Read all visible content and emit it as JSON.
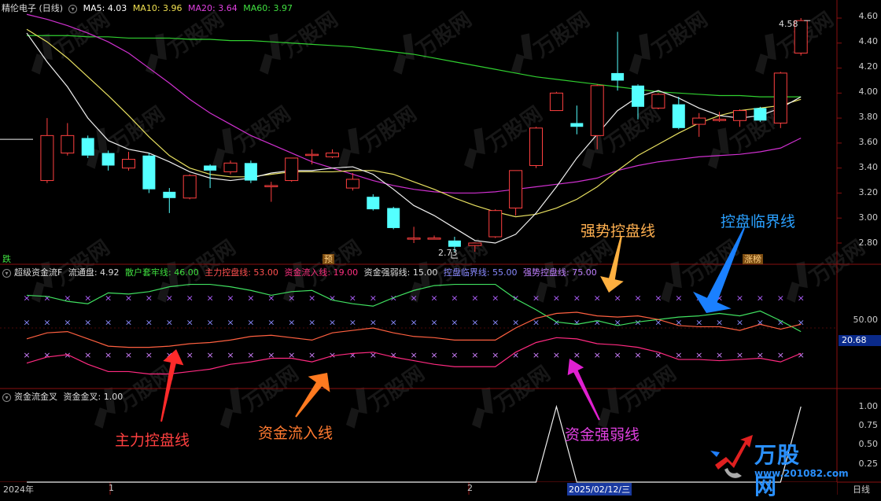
{
  "header_main": {
    "title": "精伦电子 (日线)",
    "ma": [
      {
        "label": "MA5: 4.03",
        "color": "#ffffff"
      },
      {
        "label": "MA10: 3.96",
        "color": "#f0e050"
      },
      {
        "label": "MA20: 3.64",
        "color": "#e040e0"
      },
      {
        "label": "MA60: 3.97",
        "color": "#40e040"
      }
    ]
  },
  "header_ind": {
    "title": "超级资金流F",
    "items": [
      {
        "label": "流通盘: 4.92",
        "color": "#dddddd"
      },
      {
        "label": "散户套牢线: 46.00",
        "color": "#40e040"
      },
      {
        "label": "主力控盘线: 53.00",
        "color": "#ff5050"
      },
      {
        "label": "资金流入线: 19.00",
        "color": "#ff3080"
      },
      {
        "label": "资金强弱线: 15.00",
        "color": "#dddddd"
      },
      {
        "label": "控盘临界线: 55.00",
        "color": "#8a8aff"
      },
      {
        "label": "强势控盘线: 75.00",
        "color": "#c080ff"
      }
    ]
  },
  "header_sub": {
    "title": "资金流金叉",
    "items": [
      {
        "label": "资金金叉: 1.00",
        "color": "#dddddd"
      }
    ]
  },
  "price_axis": [
    "4.60",
    "4.40",
    "4.20",
    "4.00",
    "3.80",
    "3.60",
    "3.40",
    "3.20",
    "3.00",
    "2.80"
  ],
  "ind_axis": {
    "tick": "50.00",
    "value_box": "20.68"
  },
  "sub_axis": [
    "1.00",
    "0.75",
    "0.50",
    "0.25"
  ],
  "date_axis": {
    "year": "2024年",
    "m1": "1",
    "m2": "2",
    "cursor": "2025/02/12/三",
    "period": "日线"
  },
  "markers": {
    "low_label": "2.73",
    "high_label": "4.58",
    "left_tag": "跌",
    "mid_tag": "预",
    "right_tag": "涨榜"
  },
  "annotations": {
    "strong": "强势控盘线",
    "critical": "控盘临界线",
    "main": "主力控盘线",
    "inflow": "资金流入线",
    "strength": "资金强弱线"
  },
  "watermark": {
    "brand": "万股网",
    "url": "www.201082.com"
  },
  "chart_data": {
    "type": "candlestick",
    "ylim": [
      2.7,
      4.7
    ],
    "candles": [
      {
        "o": 3.63,
        "c": 3.63,
        "h": 3.63,
        "l": 3.63
      },
      {
        "o": 3.3,
        "c": 3.66,
        "h": 3.8,
        "l": 3.28
      },
      {
        "o": 3.52,
        "c": 3.66,
        "h": 3.76,
        "l": 3.5
      },
      {
        "o": 3.64,
        "c": 3.5,
        "h": 3.66,
        "l": 3.48
      },
      {
        "o": 3.52,
        "c": 3.42,
        "h": 3.54,
        "l": 3.38
      },
      {
        "o": 3.4,
        "c": 3.47,
        "h": 3.53,
        "l": 3.38
      },
      {
        "o": 3.5,
        "c": 3.23,
        "h": 3.52,
        "l": 3.2
      },
      {
        "o": 3.21,
        "c": 3.16,
        "h": 3.24,
        "l": 3.04
      },
      {
        "o": 3.16,
        "c": 3.34,
        "h": 3.35,
        "l": 3.15
      },
      {
        "o": 3.42,
        "c": 3.38,
        "h": 3.43,
        "l": 3.24
      },
      {
        "o": 3.37,
        "c": 3.44,
        "h": 3.46,
        "l": 3.35
      },
      {
        "o": 3.44,
        "c": 3.3,
        "h": 3.46,
        "l": 3.28
      },
      {
        "o": 3.26,
        "c": 3.26,
        "h": 3.29,
        "l": 3.13
      },
      {
        "o": 3.3,
        "c": 3.48,
        "h": 3.48,
        "l": 3.29
      },
      {
        "o": 3.51,
        "c": 3.51,
        "h": 3.55,
        "l": 3.43
      },
      {
        "o": 3.49,
        "c": 3.52,
        "h": 3.55,
        "l": 3.48
      },
      {
        "o": 3.24,
        "c": 3.31,
        "h": 3.36,
        "l": 3.22
      },
      {
        "o": 3.17,
        "c": 3.07,
        "h": 3.19,
        "l": 3.06
      },
      {
        "o": 3.08,
        "c": 2.92,
        "h": 3.09,
        "l": 2.91
      },
      {
        "o": 2.84,
        "c": 2.84,
        "h": 2.93,
        "l": 2.8
      },
      {
        "o": 2.84,
        "c": 2.84,
        "h": 2.86,
        "l": 2.84
      },
      {
        "o": 2.82,
        "c": 2.77,
        "h": 2.85,
        "l": 2.73
      },
      {
        "o": 2.78,
        "c": 2.8,
        "h": 2.8,
        "l": 2.73
      },
      {
        "o": 2.85,
        "c": 3.06,
        "h": 3.07,
        "l": 2.84
      },
      {
        "o": 3.08,
        "c": 3.38,
        "h": 3.38,
        "l": 3.02
      },
      {
        "o": 3.42,
        "c": 3.72,
        "h": 3.73,
        "l": 3.4
      },
      {
        "o": 3.86,
        "c": 4.0,
        "h": 4.01,
        "l": 3.86
      },
      {
        "o": 3.76,
        "c": 3.73,
        "h": 3.9,
        "l": 3.67
      },
      {
        "o": 3.66,
        "c": 4.06,
        "h": 4.07,
        "l": 3.55
      },
      {
        "o": 4.16,
        "c": 4.1,
        "h": 4.49,
        "l": 4.02
      },
      {
        "o": 4.06,
        "c": 3.89,
        "h": 4.07,
        "l": 3.79
      },
      {
        "o": 3.88,
        "c": 3.99,
        "h": 4.0,
        "l": 3.87
      },
      {
        "o": 3.91,
        "c": 3.72,
        "h": 3.97,
        "l": 3.71
      },
      {
        "o": 3.75,
        "c": 3.8,
        "h": 3.84,
        "l": 3.65
      },
      {
        "o": 3.79,
        "c": 3.79,
        "h": 3.85,
        "l": 3.77
      },
      {
        "o": 3.78,
        "c": 3.86,
        "h": 3.87,
        "l": 3.73
      },
      {
        "o": 3.88,
        "c": 3.78,
        "h": 3.89,
        "l": 3.77
      },
      {
        "o": 3.76,
        "c": 4.16,
        "h": 4.17,
        "l": 3.72
      },
      {
        "o": 4.32,
        "c": 4.58,
        "h": 4.6,
        "l": 4.3
      }
    ],
    "ma5": [
      4.48,
      4.25,
      4.05,
      3.8,
      3.62,
      3.55,
      3.52,
      3.45,
      3.37,
      3.32,
      3.3,
      3.32,
      3.36,
      3.38,
      3.38,
      3.4,
      3.41,
      3.35,
      3.23,
      3.1,
      3.02,
      2.92,
      2.82,
      2.8,
      2.87,
      3.04,
      3.25,
      3.48,
      3.67,
      3.86,
      3.97,
      4.02,
      3.96,
      3.88,
      3.82,
      3.8,
      3.82,
      3.88,
      3.97
    ],
    "ma10": [
      4.51,
      4.41,
      4.28,
      4.13,
      3.98,
      3.82,
      3.65,
      3.5,
      3.4,
      3.35,
      3.33,
      3.33,
      3.35,
      3.37,
      3.37,
      3.37,
      3.38,
      3.38,
      3.35,
      3.29,
      3.23,
      3.16,
      3.1,
      3.05,
      3.01,
      3.03,
      3.08,
      3.15,
      3.25,
      3.38,
      3.5,
      3.59,
      3.68,
      3.76,
      3.82,
      3.86,
      3.88,
      3.9,
      3.95
    ],
    "ma20": [
      4.63,
      4.59,
      4.54,
      4.48,
      4.41,
      4.32,
      4.2,
      4.08,
      3.95,
      3.84,
      3.75,
      3.66,
      3.59,
      3.52,
      3.45,
      3.4,
      3.35,
      3.3,
      3.26,
      3.23,
      3.21,
      3.2,
      3.2,
      3.21,
      3.23,
      3.25,
      3.27,
      3.29,
      3.32,
      3.38,
      3.42,
      3.45,
      3.47,
      3.49,
      3.5,
      3.51,
      3.53,
      3.56,
      3.64
    ],
    "ma60": [
      4.46,
      4.46,
      4.46,
      4.45,
      4.45,
      4.44,
      4.44,
      4.44,
      4.43,
      4.43,
      4.42,
      4.42,
      4.41,
      4.4,
      4.39,
      4.38,
      4.37,
      4.35,
      4.33,
      4.31,
      4.28,
      4.25,
      4.22,
      4.19,
      4.16,
      4.13,
      4.11,
      4.09,
      4.07,
      4.05,
      4.03,
      4.01,
      4.0,
      3.99,
      3.98,
      3.98,
      3.97,
      3.97,
      3.97
    ],
    "ind_ylim": [
      0,
      100
    ],
    "ind_series": {
      "retail": [
        77,
        76,
        72,
        70,
        79,
        78,
        80,
        84,
        86,
        86,
        84,
        81,
        77,
        80,
        81,
        73,
        70,
        68,
        75,
        81,
        85,
        86,
        86,
        86,
        74,
        65,
        55,
        53,
        56,
        52,
        55,
        57,
        59,
        60,
        62,
        60,
        64,
        56,
        47
      ],
      "main": [
        41,
        46,
        47,
        41,
        35,
        34,
        34,
        35,
        37,
        38,
        40,
        43,
        44,
        42,
        40,
        46,
        48,
        50,
        46,
        43,
        42,
        40,
        40,
        40,
        50,
        58,
        62,
        63,
        60,
        59,
        60,
        57,
        52,
        51,
        51,
        48,
        53,
        49,
        53
      ],
      "inflow": [
        21,
        26,
        28,
        20,
        14,
        14,
        12,
        12,
        14,
        16,
        20,
        22,
        25,
        25,
        22,
        27,
        29,
        30,
        26,
        23,
        20,
        18,
        18,
        18,
        30,
        38,
        42,
        41,
        37,
        36,
        34,
        30,
        24,
        24,
        23,
        24,
        25,
        22,
        29
      ],
      "x_lines": [
        75,
        55,
        28
      ]
    },
    "sub_ylim": [
      0,
      1.1
    ],
    "sub_values": [
      0,
      0,
      0,
      0,
      0,
      0,
      0,
      0,
      0,
      0,
      0,
      0,
      0,
      0,
      0,
      0,
      0,
      0,
      0,
      0,
      0,
      0,
      0,
      0,
      0,
      0,
      1,
      0,
      0,
      0,
      0,
      0,
      0,
      0,
      0,
      0,
      0,
      0,
      1
    ]
  }
}
